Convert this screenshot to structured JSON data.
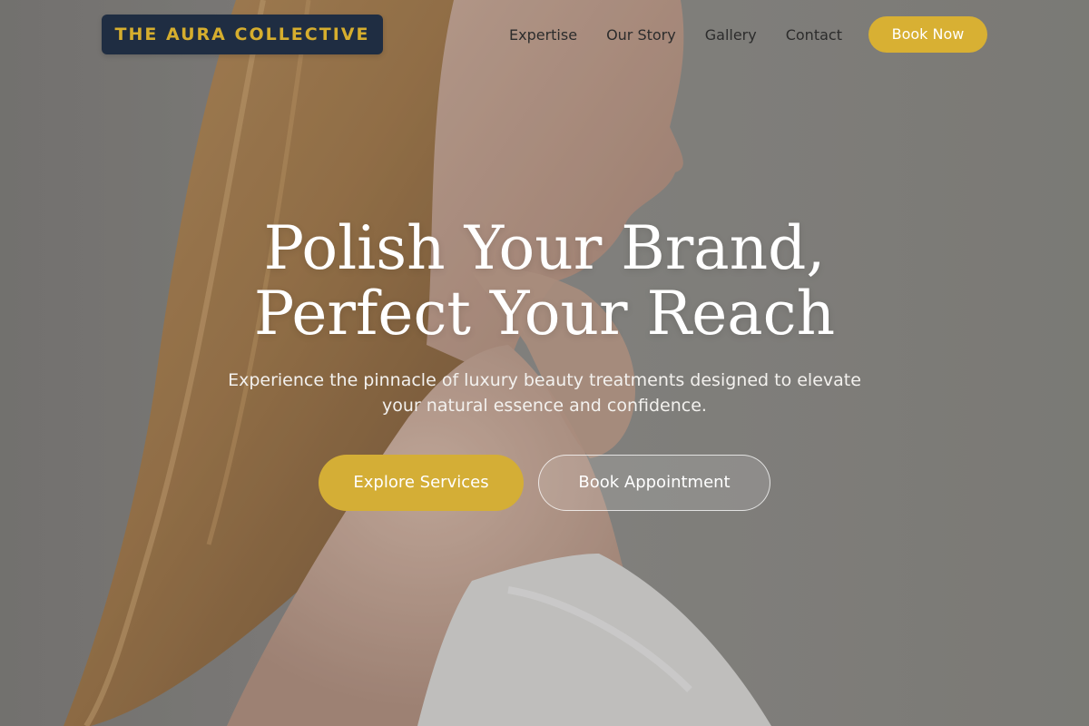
{
  "brand": {
    "logo_text": "THE AURA COLLECTIVE",
    "logo_bg": "#1f2d42",
    "accent_color": "#d8b033"
  },
  "nav": {
    "items": [
      {
        "label": "Expertise"
      },
      {
        "label": "Our Story"
      },
      {
        "label": "Gallery"
      },
      {
        "label": "Contact"
      }
    ],
    "cta_label": "Book Now"
  },
  "hero": {
    "headline_line1": "Polish Your Brand,",
    "headline_line2": "Perfect Your Reach",
    "subtitle": "Experience the pinnacle of luxury beauty treatments designed to elevate your natural essence and confidence.",
    "primary_button": "Explore Services",
    "secondary_button": "Book Appointment",
    "background_image": "woman-profile-photo"
  }
}
